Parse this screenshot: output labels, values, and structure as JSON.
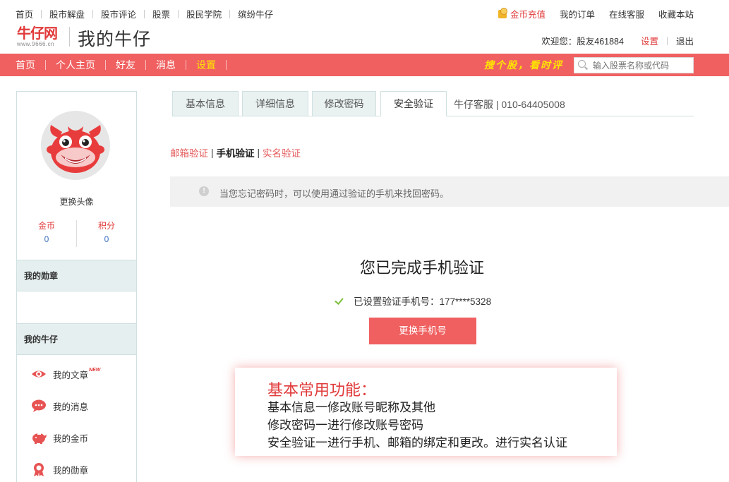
{
  "topbar": {
    "links": [
      "首页",
      "股市解盘",
      "股市评论",
      "股票",
      "股民学院",
      "缤纷牛仔"
    ],
    "coin_recharge": "金币充值",
    "my_orders": "我的订单",
    "online_service": "在线客服",
    "bookmark": "收藏本站"
  },
  "header": {
    "logo_text": "牛仔网",
    "logo_sub": "www.9666.cn",
    "brand_title": "我的牛仔",
    "welcome": "欢迎您：股友461884",
    "settings": "设置",
    "logout": "退出"
  },
  "nav": {
    "items": [
      "首页",
      "个人主页",
      "好友",
      "消息",
      "设置"
    ],
    "active_index": 4,
    "slogan": "搜个股，看时评",
    "search_placeholder": "输入股票名称或代码"
  },
  "sidebar": {
    "change_avatar": "更换头像",
    "coins_label": "金币",
    "coins_value": "0",
    "points_label": "积分",
    "points_value": "0",
    "medals_heading": "我的勋章",
    "my_niuzai_heading": "我的牛仔",
    "menu": [
      {
        "label": "我的文章",
        "icon": "eye-icon",
        "badge": "NEW"
      },
      {
        "label": "我的消息",
        "icon": "chat-bubble-icon"
      },
      {
        "label": "我的金币",
        "icon": "piggy-bank-icon"
      },
      {
        "label": "我的勋章",
        "icon": "medal-icon"
      }
    ]
  },
  "tabs": {
    "items": [
      "基本信息",
      "详细信息",
      "修改密码",
      "安全验证"
    ],
    "active_index": 3,
    "service_phone": "牛仔客服 | 010-64405008"
  },
  "subnav": {
    "email": "邮箱验证",
    "phone": "手机验证",
    "realname": "实名验证",
    "separator": "|"
  },
  "notice": {
    "text": "当您忘记密码时，可以使用通过验证的手机来找回密码。"
  },
  "verify": {
    "title": "您已完成手机验证",
    "phone_line": "已设置验证手机号：177****5328",
    "change_button": "更换手机号"
  },
  "callout": {
    "title": "基本常用功能：",
    "lines": [
      "基本信息一修改账号昵称及其他",
      "修改密码一进行修改账号密码",
      "安全验证一进行手机、邮箱的绑定和更改。进行实名认证"
    ]
  },
  "colors": {
    "brand_red": "#f06060",
    "nav_active": "#ffe600",
    "link_red": "#e13a3a",
    "stat_blue": "#3a6fc0",
    "panel_bg": "#e6efef"
  }
}
